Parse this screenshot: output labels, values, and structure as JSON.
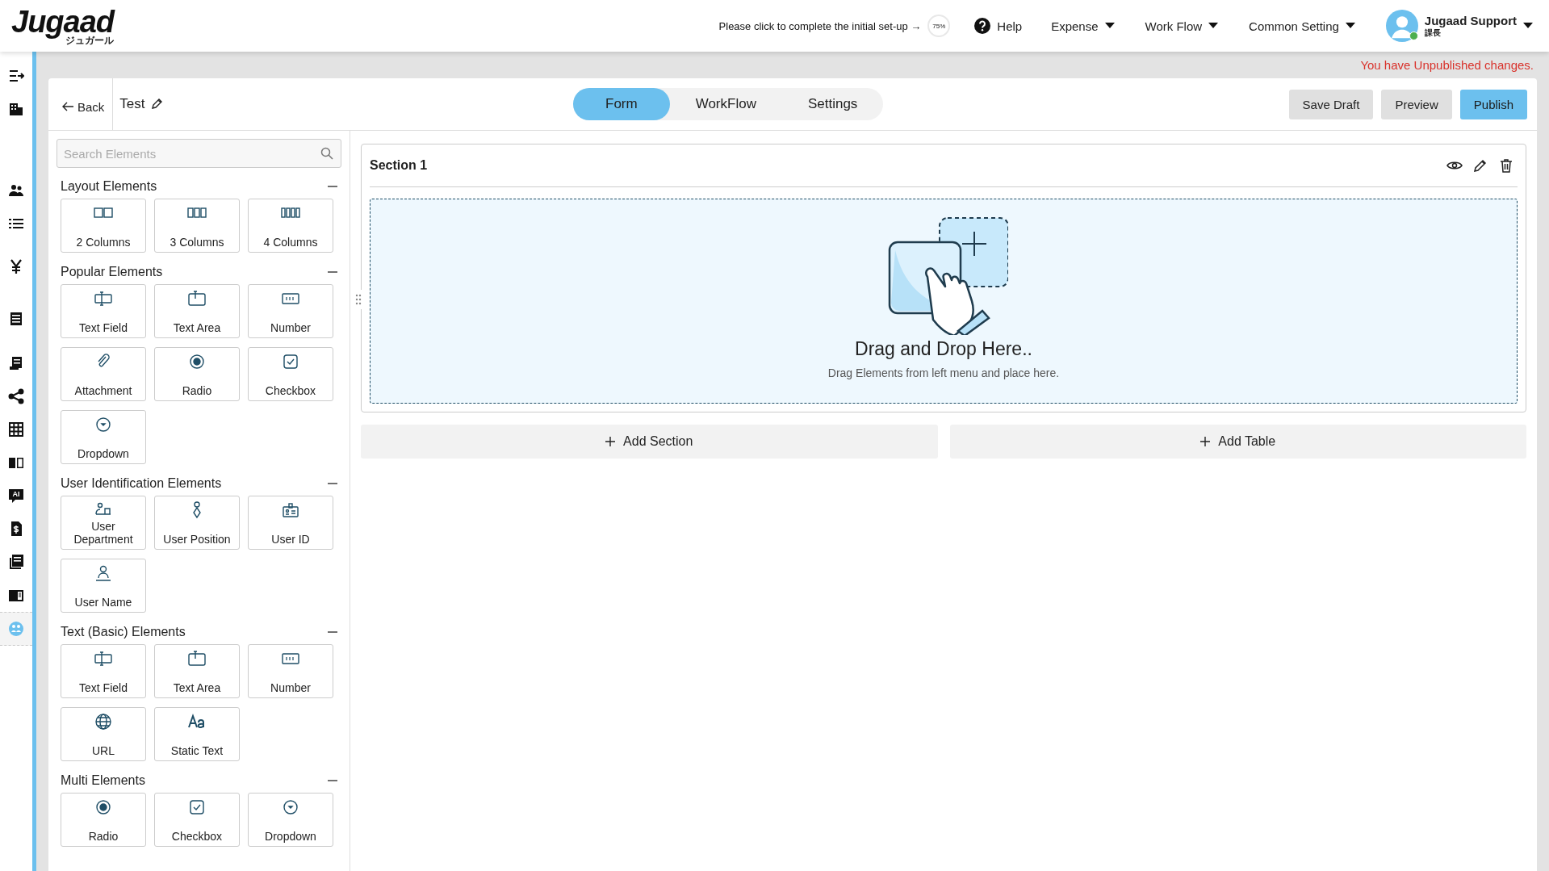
{
  "header": {
    "logo": "Jugaad",
    "logo_sub": "ジュガール",
    "setup_prompt": "Please click to complete the initial set-up →",
    "setup_percentage": "75%",
    "help": "Help",
    "menus": [
      {
        "label": "Expense"
      },
      {
        "label": "Work Flow"
      },
      {
        "label": "Common Setting"
      }
    ],
    "user": {
      "name": "Jugaad Support",
      "role": "課長",
      "online": true
    }
  },
  "nav_rail": {
    "items": [
      {
        "selected": false
      },
      {
        "selected": false
      },
      {
        "selected": false
      },
      {
        "selected": false
      },
      {
        "selected": false
      },
      {
        "selected": false
      },
      {
        "selected": false
      },
      {
        "selected": false
      },
      {
        "selected": false
      },
      {
        "selected": false
      },
      {
        "selected": false,
        "badge": "AI"
      },
      {
        "selected": false
      },
      {
        "selected": false
      },
      {
        "selected": false
      },
      {
        "selected": true
      }
    ]
  },
  "notice": "You have Unpublished changes.",
  "toolbar": {
    "back": "Back",
    "form_name": "Test",
    "tabs": [
      {
        "label": "Form",
        "selected": true
      },
      {
        "label": "WorkFlow",
        "selected": false
      },
      {
        "label": "Settings",
        "selected": false
      }
    ],
    "buttons": [
      {
        "label": "Save Draft",
        "kind": "secondary"
      },
      {
        "label": "Preview",
        "kind": "secondary"
      },
      {
        "label": "Publish",
        "kind": "primary"
      }
    ]
  },
  "palette": {
    "search": {
      "placeholder": "Search Elements"
    },
    "groups": [
      {
        "title": "Layout Elements",
        "expanded": true,
        "items": [
          {
            "label": "2 Columns",
            "kind": "cols2"
          },
          {
            "label": "3 Columns",
            "kind": "cols3"
          },
          {
            "label": "4 Columns",
            "kind": "cols4"
          }
        ]
      },
      {
        "title": "Popular Elements",
        "expanded": true,
        "items": [
          {
            "label": "Text Field",
            "kind": "textfield"
          },
          {
            "label": "Text Area",
            "kind": "textarea"
          },
          {
            "label": "Number",
            "kind": "number"
          },
          {
            "label": "Attachment",
            "kind": "attachment"
          },
          {
            "label": "Radio",
            "kind": "radio"
          },
          {
            "label": "Checkbox",
            "kind": "checkbox"
          },
          {
            "label": "Dropdown",
            "kind": "dropdown"
          }
        ]
      },
      {
        "title": "User Identification Elements",
        "expanded": true,
        "items": [
          {
            "label": "User Department",
            "kind": "department"
          },
          {
            "label": "User Position",
            "kind": "position"
          },
          {
            "label": "User ID",
            "kind": "userid"
          },
          {
            "label": "User Name",
            "kind": "username"
          }
        ]
      },
      {
        "title": "Text (Basic) Elements",
        "expanded": true,
        "items": [
          {
            "label": "Text Field",
            "kind": "textfield"
          },
          {
            "label": "Text Area",
            "kind": "textarea"
          },
          {
            "label": "Number",
            "kind": "number"
          },
          {
            "label": "URL",
            "kind": "url"
          },
          {
            "label": "Static Text",
            "kind": "static"
          }
        ]
      },
      {
        "title": "Multi Elements",
        "expanded": true,
        "items": [
          {
            "label": "Radio",
            "kind": "radio"
          },
          {
            "label": "Checkbox",
            "kind": "checkbox"
          },
          {
            "label": "Dropdown",
            "kind": "dropdown"
          }
        ]
      }
    ]
  },
  "canvas": {
    "sections": [
      {
        "title": "Section 1",
        "dropzone": {
          "title": "Drag and Drop Here..",
          "hint": "Drag Elements from left menu and place here."
        }
      }
    ],
    "actions": [
      {
        "label": "Add Section"
      },
      {
        "label": "Add Table"
      }
    ]
  }
}
